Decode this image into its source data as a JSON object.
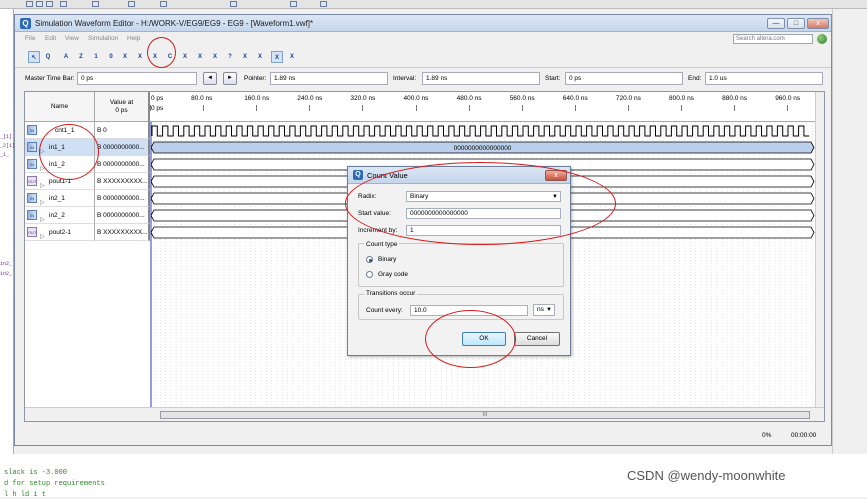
{
  "window": {
    "title": "Simulation Waveform Editor - H:/WORK-V/EG9/EG9 - EG9 - [Waveform1.vwf]*",
    "min": "—",
    "max": "□",
    "close": "x"
  },
  "menu": [
    "File",
    "Edit",
    "View",
    "Simulation",
    "Help"
  ],
  "search_placeholder": "Search altera.com",
  "toolbar": [
    "↖",
    "Q",
    "A",
    "Z",
    "1",
    "0",
    "X",
    "X",
    "X",
    "C",
    "X",
    "X",
    "X",
    "?",
    "X",
    "X",
    "X",
    "X"
  ],
  "timebar": {
    "master_label": "Master Time Bar:",
    "master_value": "0 ps",
    "prev": "◄",
    "next": "►",
    "pointer_label": "Pointer:",
    "pointer_value": "1.89 ns",
    "interval_label": "Interval:",
    "interval_value": "1.89 ns",
    "start_label": "Start:",
    "start_value": "0 ps",
    "end_label": "End:",
    "end_value": "1.0 us"
  },
  "grid": {
    "name_header": "Name",
    "value_header_1": "Value at",
    "value_header_2": "0 ps",
    "cursor_label": "0 ps",
    "ticks": [
      "0 ps",
      "80.0 ns",
      "160.0 ns",
      "240.0 ns",
      "320.0 ns",
      "400.0 ns",
      "480.0 ns",
      "560.0 ns",
      "640.0 ns",
      "720.0 ns",
      "800.0 ns",
      "880.0 ns",
      "960.0 ns"
    ],
    "rows": [
      {
        "name": "cnt1_1",
        "value": "B 0",
        "icon": "in",
        "expand": ""
      },
      {
        "name": "in1_1",
        "value": "B 0000000000...",
        "icon": "in",
        "expand": "▷",
        "bus_value": "0000000000000000"
      },
      {
        "name": "in1_2",
        "value": "B 0000000000...",
        "icon": "in",
        "expand": "▷"
      },
      {
        "name": "pout1-1",
        "value": "B XXXXXXXXX...",
        "icon": "out",
        "expand": "▷"
      },
      {
        "name": "in2_1",
        "value": "B 0000000000...",
        "icon": "in",
        "expand": "▷"
      },
      {
        "name": "in2_2",
        "value": "B 0000000000...",
        "icon": "in",
        "expand": "▷"
      },
      {
        "name": "pout2-1",
        "value": "B XXXXXXXXX...",
        "icon": "out",
        "expand": "▷"
      }
    ],
    "scroll_grip": "III"
  },
  "status": {
    "progress": "0%",
    "time": "00:00:00"
  },
  "dialog": {
    "title": "Count Value",
    "close": "x",
    "radix_label": "Radix:",
    "radix_value": "Binary",
    "start_label": "Start value:",
    "start_value": "0000000000000000",
    "increment_label": "Increment by:",
    "increment_value": "1",
    "count_type_label": "Count type",
    "binary_label": "Binary",
    "gray_label": "Gray code",
    "transitions_label": "Transitions occur",
    "count_every_label": "Count every:",
    "count_every_value": "10.0",
    "unit_value": "ns",
    "ok": "OK",
    "cancel": "Cancel"
  },
  "left_edge": [
    "_[1]",
    "_2[1]",
    "_1_",
    "in2_",
    "in2_"
  ],
  "console": [
    "slack is -3.000",
    "d for setup requirements",
    "l   h   ld   i   t"
  ],
  "watermark": "CSDN @wendy-moonwhite",
  "colors": {
    "accent": "#2d6bb5",
    "annotation": "#d51a1a",
    "bus_fill": "#bcd0ec"
  }
}
